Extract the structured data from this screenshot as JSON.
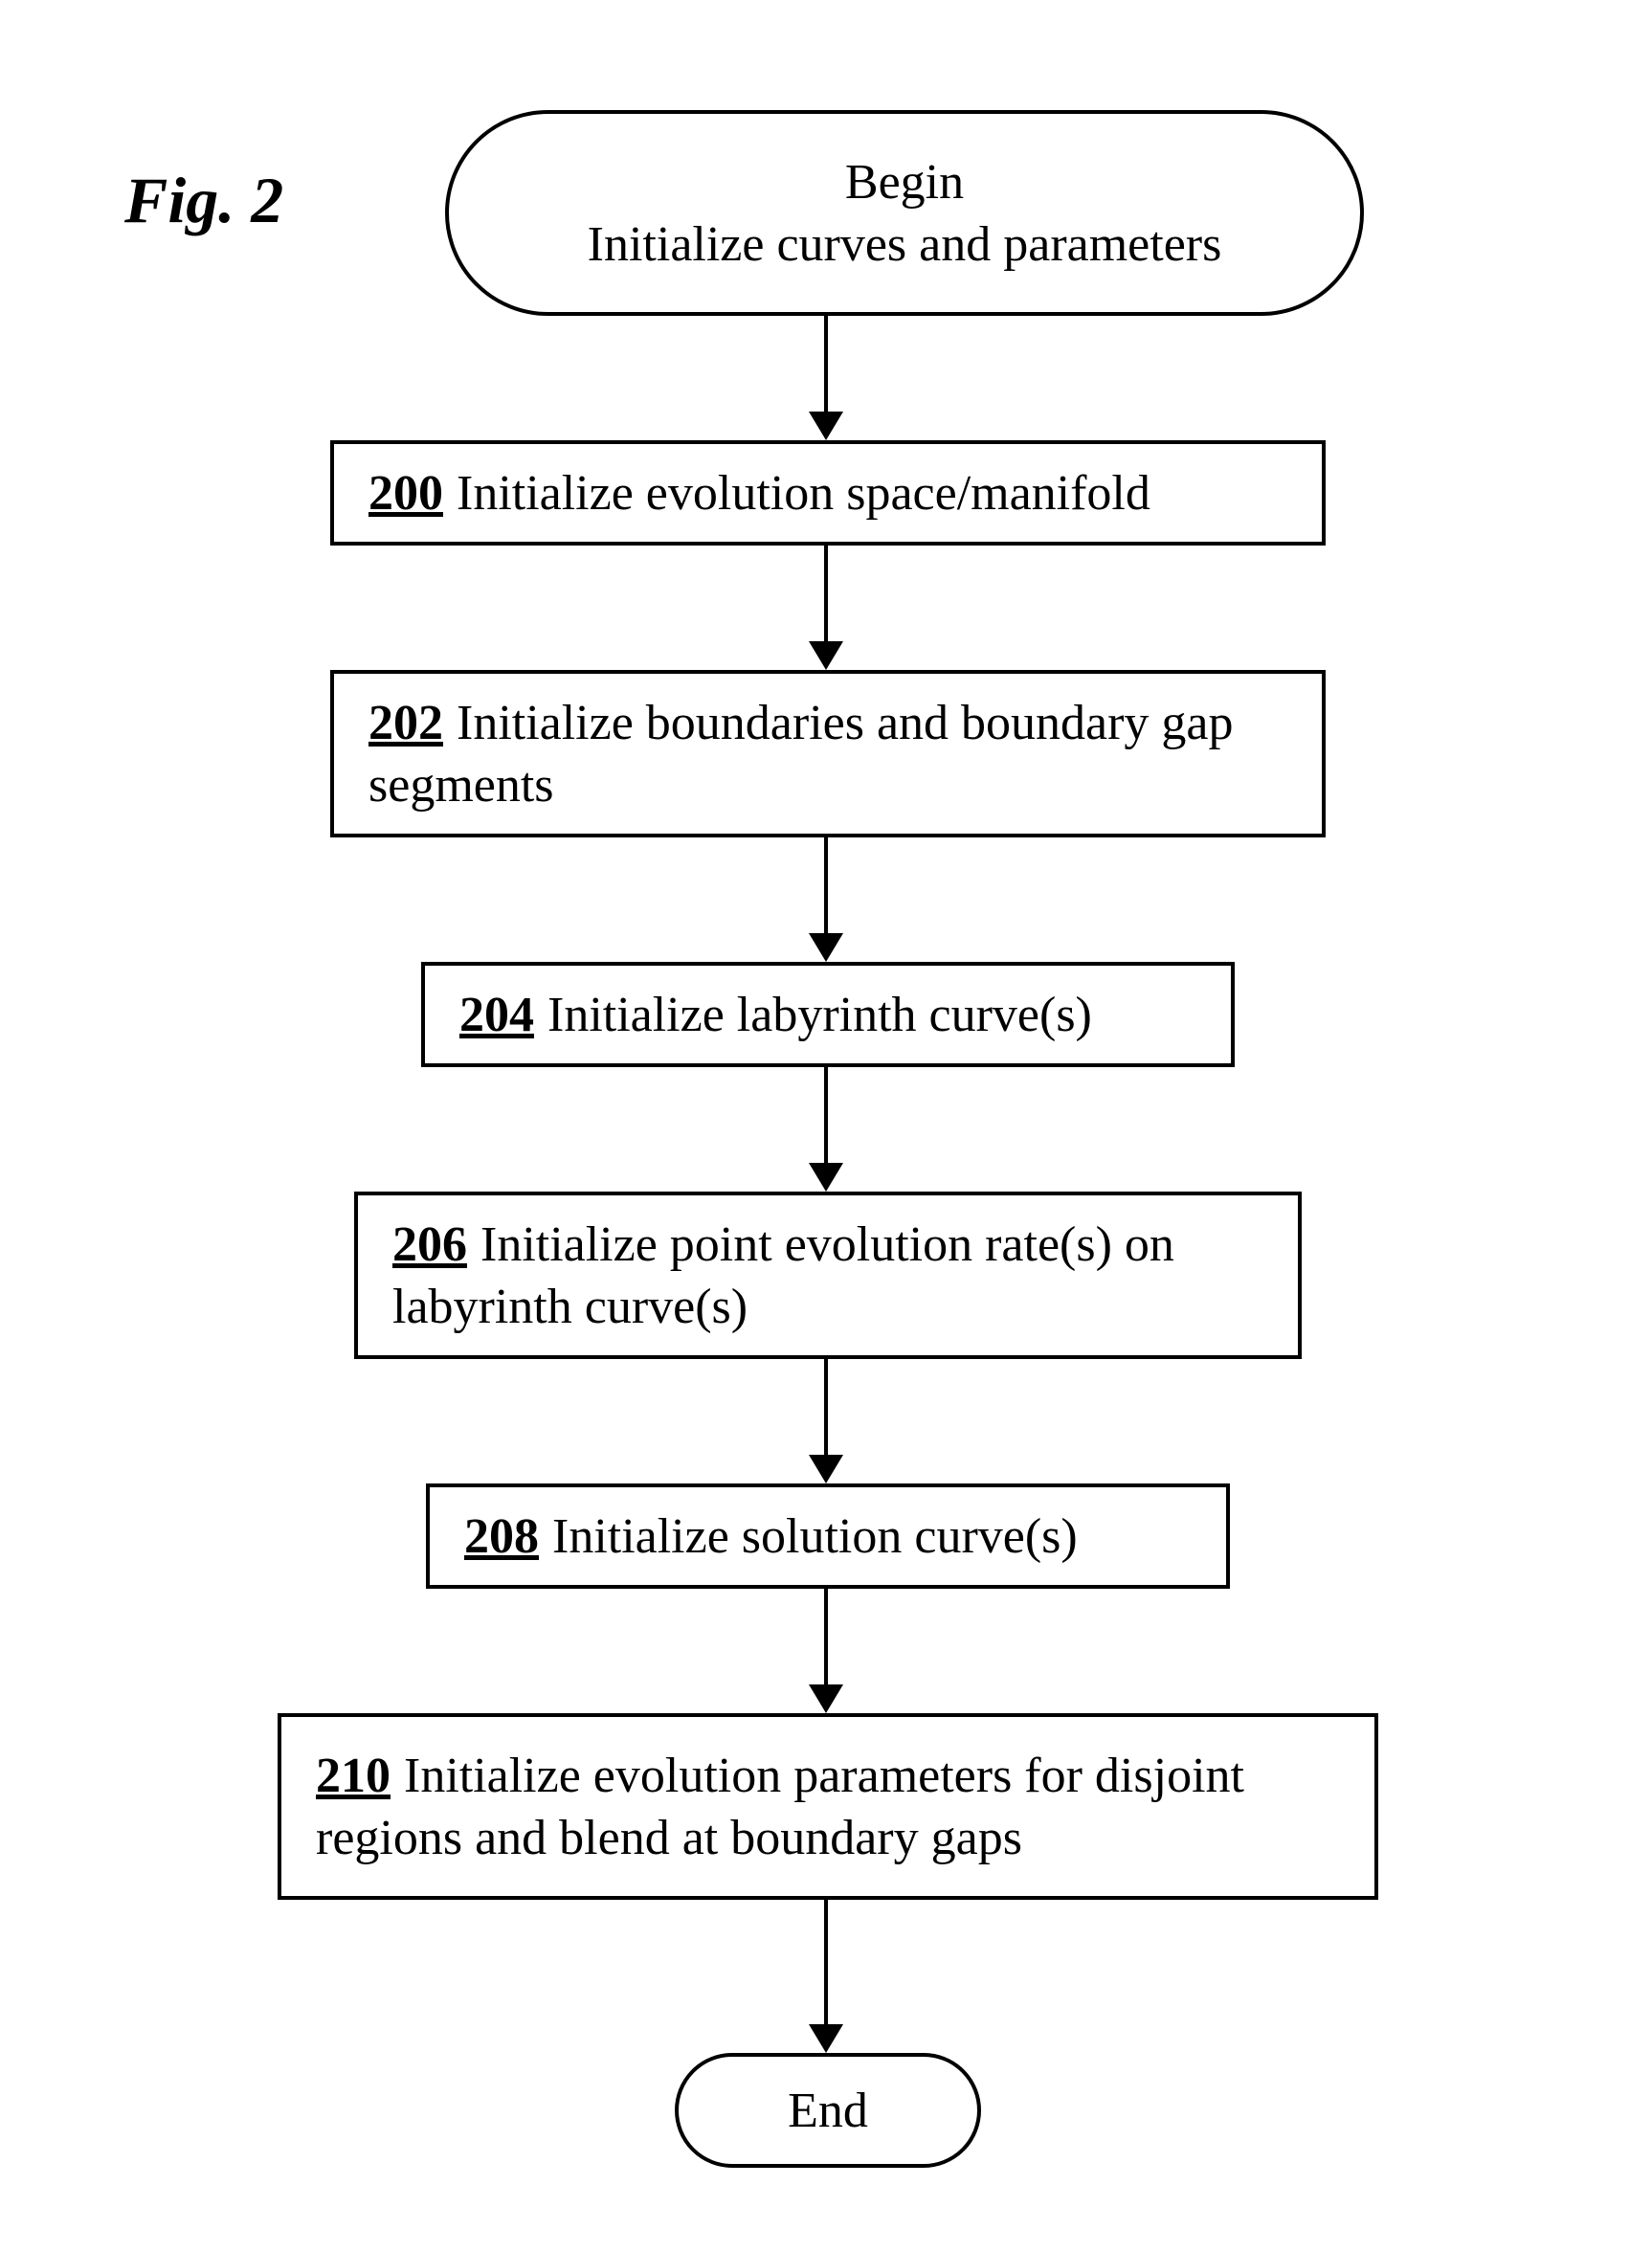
{
  "figure_label": "Fig. 2",
  "start": {
    "line1": "Begin",
    "line2": "Initialize curves and parameters"
  },
  "steps": [
    {
      "num": "200",
      "text": "Initialize evolution space/manifold"
    },
    {
      "num": "202",
      "text": "Initialize boundaries and boundary gap segments"
    },
    {
      "num": "204",
      "text": "Initialize labyrinth curve(s)"
    },
    {
      "num": "206",
      "text": "Initialize point evolution rate(s) on labyrinth curve(s)"
    },
    {
      "num": "208",
      "text": "Initialize solution curve(s)"
    },
    {
      "num": "210",
      "text": "Initialize evolution parameters for disjoint regions and blend at boundary gaps"
    }
  ],
  "end": "End"
}
